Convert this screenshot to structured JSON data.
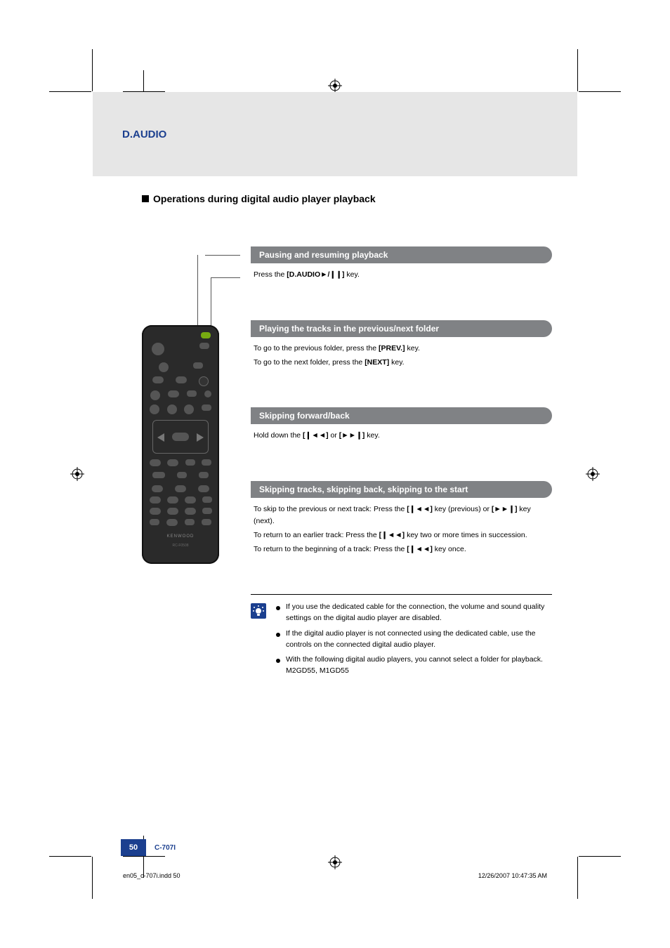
{
  "header": {
    "section_title": "D.AUDIO"
  },
  "section": {
    "heading": "Operations during digital audio player playback"
  },
  "blocks": {
    "pause": {
      "title": "Pausing and resuming playback",
      "line1_pre": "Press the ",
      "line1_key": "[D.AUDIO►/❙❙]",
      "line1_post": " key."
    },
    "folder": {
      "title": "Playing the tracks in the previous/next folder",
      "prev_pre": "To go to the previous folder, press the ",
      "prev_key": "[PREV.]",
      "prev_post": " key.",
      "next_pre": "To go to the next folder, press the ",
      "next_key": "[NEXT]",
      "next_post": " key."
    },
    "skipfb": {
      "title": "Skipping forward/back",
      "line_pre": "Hold down the ",
      "key1": "[❙◄◄]",
      "mid": " or ",
      "key2": "[►►❙]",
      "line_post": " key."
    },
    "skiptrack": {
      "title": "Skipping tracks, skipping back, skipping to the start",
      "l1_pre": "To skip to the previous or next track: Press the ",
      "l1_k1": "[❙◄◄]",
      "l1_mid": " key (previous) or ",
      "l1_k2": "[►►❙]",
      "l1_post": " key (next).",
      "l2_pre": "To return to an earlier track: Press the ",
      "l2_k": "[❙◄◄]",
      "l2_post": " key two or more times in succession.",
      "l3_pre": "To return to the beginning of a track: Press the ",
      "l3_k": "[❙◄◄]",
      "l3_post": " key once."
    }
  },
  "tips": {
    "items": [
      "If you use the dedicated cable for the connection, the volume and sound quality settings on the digital audio player are disabled.",
      "If the digital audio player is not connected using the dedicated cable, use the controls on the connected digital audio player.",
      "With the following digital audio players, you cannot select a folder for playback. M2GD55, M1GD55"
    ]
  },
  "remote": {
    "brand": "KENWOOD",
    "model": "RC-F0508"
  },
  "footer": {
    "page": "50",
    "model": "C-707I"
  },
  "slug": {
    "file": "en05_c-707i.indd   50",
    "timestamp": "12/26/2007   10:47:35 AM"
  }
}
